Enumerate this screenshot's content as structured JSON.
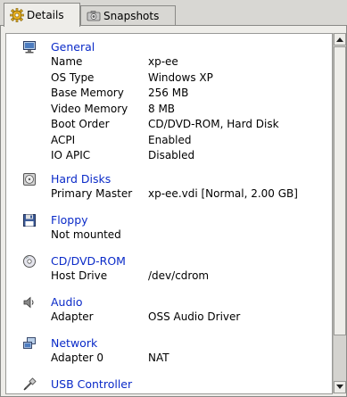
{
  "tabs": [
    {
      "label": "Details",
      "icon": "gear-icon",
      "active": true
    },
    {
      "label": "Snapshots",
      "icon": "camera-icon",
      "active": false
    }
  ],
  "sections": {
    "general": {
      "title": "General",
      "icon": "monitor-icon",
      "rows": [
        {
          "key": "Name",
          "value": "xp-ee"
        },
        {
          "key": "OS Type",
          "value": "Windows XP"
        },
        {
          "key": "Base Memory",
          "value": "256 MB"
        },
        {
          "key": "Video Memory",
          "value": "8 MB"
        },
        {
          "key": "Boot Order",
          "value": "CD/DVD-ROM, Hard Disk"
        },
        {
          "key": "ACPI",
          "value": "Enabled"
        },
        {
          "key": "IO APIC",
          "value": "Disabled"
        }
      ]
    },
    "hard_disks": {
      "title": "Hard Disks",
      "icon": "hard-disk-icon",
      "rows": [
        {
          "key": "Primary Master",
          "value": "xp-ee.vdi [Normal, 2.00 GB]"
        }
      ]
    },
    "floppy": {
      "title": "Floppy",
      "icon": "floppy-icon",
      "rows": [
        {
          "key": "Not mounted",
          "value": ""
        }
      ]
    },
    "cdrom": {
      "title": "CD/DVD-ROM",
      "icon": "cd-icon",
      "rows": [
        {
          "key": "Host Drive",
          "value": "/dev/cdrom"
        }
      ]
    },
    "audio": {
      "title": "Audio",
      "icon": "speaker-icon",
      "rows": [
        {
          "key": "Adapter",
          "value": "OSS Audio Driver"
        }
      ]
    },
    "network": {
      "title": "Network",
      "icon": "network-icon",
      "rows": [
        {
          "key": "Adapter 0",
          "value": "NAT"
        }
      ]
    },
    "usb": {
      "title": "USB Controller",
      "icon": "usb-icon",
      "rows": []
    }
  },
  "colors": {
    "section_title": "#0a2ac8",
    "panel_bg": "#eeede9",
    "content_bg": "#ffffff"
  }
}
